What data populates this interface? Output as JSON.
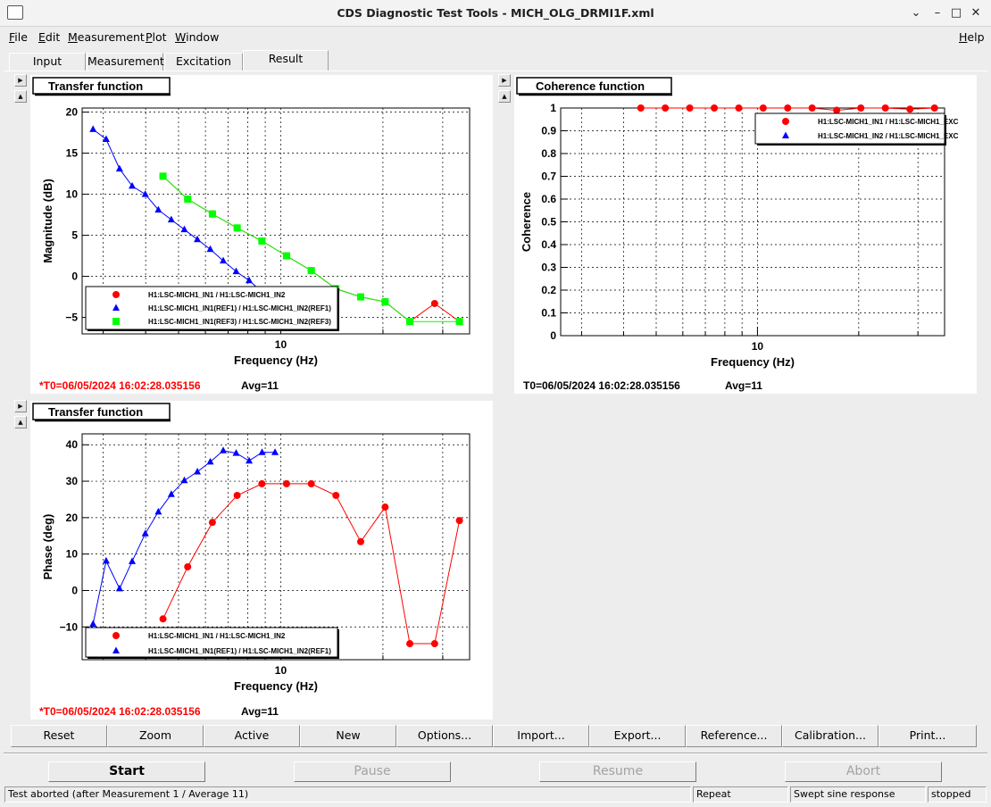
{
  "window": {
    "title": "CDS Diagnostic Test Tools - MICH_OLG_DRMI1F.xml"
  },
  "menu": {
    "left": [
      {
        "label": "File",
        "u": "F",
        "rest": "ile"
      },
      {
        "label": "Edit",
        "u": "E",
        "rest": "dit"
      },
      {
        "label": "Measurement",
        "u": "M",
        "rest": "easurement"
      },
      {
        "label": "Plot",
        "u": "P",
        "rest": "lot"
      },
      {
        "label": "Window",
        "u": "W",
        "rest": "indow"
      }
    ],
    "help": {
      "label": "Help",
      "u": "H",
      "rest": "elp"
    }
  },
  "tabs": [
    "Input",
    "Measurement",
    "Excitation",
    "Result"
  ],
  "active_tab": "Result",
  "buttons": [
    "Reset",
    "Zoom",
    "Active",
    "New",
    "Options...",
    "Import...",
    "Export...",
    "Reference...",
    "Calibration...",
    "Print..."
  ],
  "controls": {
    "start": "Start",
    "pause": "Pause",
    "resume": "Resume",
    "abort": "Abort"
  },
  "status": {
    "message": "Test aborted (after Measurement 1 / Average 11)",
    "mode": "Repeat",
    "type": "Swept sine response",
    "state": "stopped"
  },
  "colors": {
    "red": "#ff0000",
    "blue": "#0000ff",
    "green": "#00ff00",
    "stamp_red": "#ff0000"
  },
  "chart_data": [
    {
      "type": "line",
      "title": "Transfer function",
      "xlabel": "Frequency (Hz)",
      "ylabel": "Magnitude (dB)",
      "xscale": "log",
      "xlim": [
        2.6,
        36
      ],
      "ylim": [
        -7,
        20.5
      ],
      "yticks": [
        -5,
        0,
        5,
        10,
        15,
        20
      ],
      "xticks_labeled": [
        10
      ],
      "grid": true,
      "legend": "bottom-left",
      "series": [
        {
          "name": "H1:LSC-MICH1_IN1 / H1:LSC-MICH1_IN2",
          "color": "#ff0000",
          "marker": "circle",
          "x": [
            4.5,
            5.32,
            6.29,
            7.44,
            8.8,
            10.4,
            12.3,
            14.54,
            17.2,
            20.3,
            24.0,
            28.4,
            33.6
          ],
          "y": [
            12.2,
            9.4,
            7.6,
            5.9,
            4.3,
            2.5,
            0.7,
            -1.5,
            -2.5,
            -3.1,
            -5.5,
            -3.3,
            -5.5
          ]
        },
        {
          "name": "H1:LSC-MICH1_IN1(REF1) / H1:LSC-MICH1_IN2(REF1)",
          "color": "#0000ff",
          "marker": "triangle",
          "x": [
            2.8,
            3.06,
            3.35,
            3.65,
            3.99,
            4.36,
            4.76,
            5.2,
            5.68,
            6.2,
            6.77,
            7.39,
            8.07,
            8.81,
            9.62
          ],
          "y": [
            17.9,
            16.7,
            13.1,
            11.0,
            10.0,
            8.1,
            6.9,
            5.7,
            4.5,
            3.3,
            1.9,
            0.6,
            -0.5,
            -1.9,
            -1.9
          ]
        },
        {
          "name": "H1:LSC-MICH1_IN1(REF3) / H1:LSC-MICH1_IN2(REF3)",
          "color": "#00ff00",
          "marker": "square",
          "x": [
            4.5,
            5.32,
            6.29,
            7.44,
            8.8,
            10.4,
            12.3,
            14.54,
            17.2,
            20.3,
            24.0,
            33.6
          ],
          "y": [
            12.2,
            9.4,
            7.6,
            5.9,
            4.3,
            2.5,
            0.7,
            -1.5,
            -2.5,
            -3.1,
            -5.5,
            -5.5
          ]
        }
      ]
    },
    {
      "type": "line",
      "title": "Coherence function",
      "xlabel": "Frequency (Hz)",
      "ylabel": "Coherence",
      "xscale": "log",
      "xlim": [
        2.6,
        36
      ],
      "ylim": [
        0,
        1.0
      ],
      "yticks": [
        0,
        0.1,
        0.2,
        0.3,
        0.4,
        0.5,
        0.6,
        0.7,
        0.8,
        0.9,
        1
      ],
      "xticks_labeled": [
        10
      ],
      "grid": true,
      "legend": "top-right",
      "series": [
        {
          "name": "H1:LSC-MICH1_IN1 / H1:LSC-MICH1_EXC",
          "color": "#ff0000",
          "marker": "circle",
          "x": [
            4.5,
            5.32,
            6.29,
            7.44,
            8.8,
            10.4,
            12.3,
            14.54,
            17.2,
            20.3,
            24.0,
            28.4,
            33.6
          ],
          "y": [
            1.0,
            1.0,
            1.0,
            1.0,
            1.0,
            1.0,
            1.0,
            1.0,
            0.99,
            1.0,
            1.0,
            0.995,
            1.0
          ]
        },
        {
          "name": "H1:LSC-MICH1_IN2 / H1:LSC-MICH1_EXC",
          "color": "#0000ff",
          "marker": "triangle",
          "x": [],
          "y": []
        }
      ]
    },
    {
      "type": "line",
      "title": "Transfer function",
      "xlabel": "Frequency (Hz)",
      "ylabel": "Phase (deg)",
      "xscale": "log",
      "xlim": [
        2.6,
        36
      ],
      "ylim": [
        -19,
        43
      ],
      "yticks": [
        -10,
        0,
        10,
        20,
        30,
        40
      ],
      "xticks_labeled": [
        10
      ],
      "grid": true,
      "legend": "bottom-left",
      "series": [
        {
          "name": "H1:LSC-MICH1_IN1 / H1:LSC-MICH1_IN2",
          "color": "#ff0000",
          "marker": "circle",
          "x": [
            4.5,
            5.32,
            6.29,
            7.44,
            8.8,
            10.4,
            12.3,
            14.54,
            17.2,
            20.3,
            24.0,
            28.4,
            33.6
          ],
          "y": [
            -7.8,
            6.5,
            18.7,
            26.1,
            29.3,
            29.3,
            29.3,
            26.1,
            13.4,
            22.9,
            -14.6,
            -14.6,
            19.2
          ]
        },
        {
          "name": "H1:LSC-MICH1_IN1(REF1) / H1:LSC-MICH1_IN2(REF1)",
          "color": "#0000ff",
          "marker": "triangle",
          "x": [
            2.8,
            3.06,
            3.35,
            3.65,
            3.99,
            4.36,
            4.76,
            5.2,
            5.68,
            6.2,
            6.77,
            7.39,
            8.07,
            8.81,
            9.62
          ],
          "y": [
            -9.2,
            8.1,
            0.5,
            8.0,
            15.6,
            21.6,
            26.4,
            30.2,
            32.6,
            35.3,
            38.4,
            37.7,
            35.6,
            37.9,
            37.9
          ]
        }
      ]
    }
  ],
  "plots": [
    {
      "title": "Transfer function",
      "timestamp": "*T0=06/05/2024 16:02:28.035156",
      "avg": "Avg=11",
      "stamp_red": true
    },
    {
      "title": "Coherence function",
      "timestamp": "T0=06/05/2024 16:02:28.035156",
      "avg": "Avg=11",
      "stamp_red": false
    },
    {
      "title": "Transfer function",
      "timestamp": "*T0=06/05/2024 16:02:28.035156",
      "avg": "Avg=11",
      "stamp_red": true
    }
  ]
}
